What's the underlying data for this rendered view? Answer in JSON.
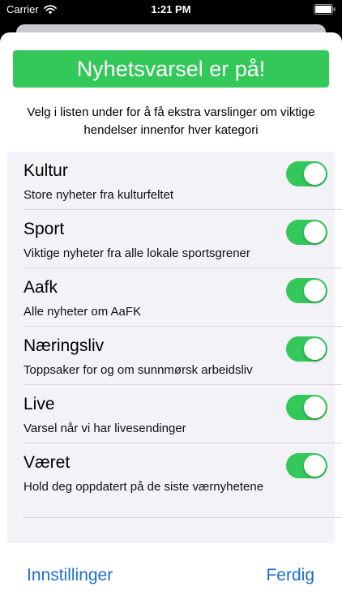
{
  "status_bar": {
    "carrier": "Carrier",
    "time": "1:21 PM"
  },
  "banner": {
    "text": "Nyhetsvarsel er på!",
    "color": "#34c759"
  },
  "description": "Velg i listen under for å få ekstra varslinger om viktige hendelser innenfor hver kategori",
  "categories": [
    {
      "title": "Kultur",
      "subtitle": "Store nyheter fra kulturfeltet",
      "enabled": true
    },
    {
      "title": "Sport",
      "subtitle": "Viktige nyheter fra alle lokale sportsgrener",
      "enabled": true
    },
    {
      "title": "Aafk",
      "subtitle": "Alle nyheter om AaFK",
      "enabled": true
    },
    {
      "title": "Næringsliv",
      "subtitle": "Toppsaker for og om sunnmørsk arbeidsliv",
      "enabled": true
    },
    {
      "title": "Live",
      "subtitle": "Varsel når vi har livesendinger",
      "enabled": true
    },
    {
      "title": "Været",
      "subtitle": "Hold deg oppdatert på de siste værnyhetene",
      "enabled": true
    }
  ],
  "footer": {
    "settings_label": "Innstillinger",
    "done_label": "Ferdig"
  },
  "colors": {
    "accent": "#1a6fd0",
    "toggle_on": "#34c759"
  }
}
